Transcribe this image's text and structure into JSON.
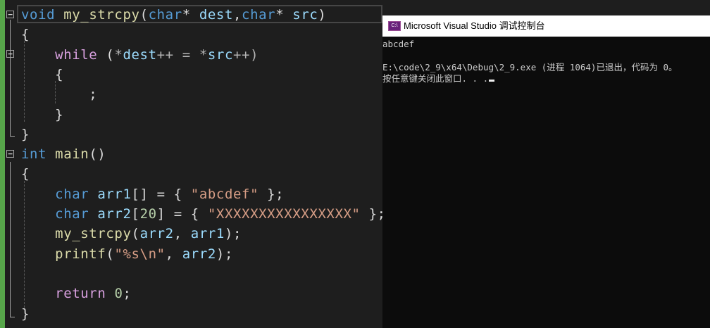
{
  "editor": {
    "lines": [
      [
        {
          "t": "void",
          "c": "kw"
        },
        {
          "t": " "
        },
        {
          "t": "my_strcpy",
          "c": "fn"
        },
        {
          "t": "("
        },
        {
          "t": "char",
          "c": "kw"
        },
        {
          "t": "* "
        },
        {
          "t": "dest",
          "c": "var"
        },
        {
          "t": ","
        },
        {
          "t": "char",
          "c": "kw"
        },
        {
          "t": "* "
        },
        {
          "t": "src",
          "c": "var"
        },
        {
          "t": ")"
        }
      ],
      [
        {
          "t": "{"
        }
      ],
      [
        {
          "t": "    "
        },
        {
          "t": "while",
          "c": "ctrl"
        },
        {
          "t": " ("
        },
        {
          "t": "*",
          "c": "op"
        },
        {
          "t": "dest",
          "c": "var"
        },
        {
          "t": "++ = ",
          "c": "op"
        },
        {
          "t": "*",
          "c": "op"
        },
        {
          "t": "src",
          "c": "var"
        },
        {
          "t": "++)",
          "c": "op"
        }
      ],
      [
        {
          "t": "    {"
        }
      ],
      [
        {
          "t": "        ;"
        }
      ],
      [
        {
          "t": "    }"
        }
      ],
      [
        {
          "t": "}"
        }
      ],
      [
        {
          "t": "int",
          "c": "kw"
        },
        {
          "t": " "
        },
        {
          "t": "main",
          "c": "fn"
        },
        {
          "t": "()"
        }
      ],
      [
        {
          "t": "{"
        }
      ],
      [
        {
          "t": "    "
        },
        {
          "t": "char",
          "c": "kw"
        },
        {
          "t": " "
        },
        {
          "t": "arr1",
          "c": "var"
        },
        {
          "t": "[] = { "
        },
        {
          "t": "\"abcdef\"",
          "c": "str"
        },
        {
          "t": " };"
        }
      ],
      [
        {
          "t": "    "
        },
        {
          "t": "char",
          "c": "kw"
        },
        {
          "t": " "
        },
        {
          "t": "arr2",
          "c": "var"
        },
        {
          "t": "["
        },
        {
          "t": "20",
          "c": "num"
        },
        {
          "t": "] = { "
        },
        {
          "t": "\"XXXXXXXXXXXXXXXX\"",
          "c": "str"
        },
        {
          "t": " };"
        }
      ],
      [
        {
          "t": "    "
        },
        {
          "t": "my_strcpy",
          "c": "fn"
        },
        {
          "t": "("
        },
        {
          "t": "arr2",
          "c": "var"
        },
        {
          "t": ", "
        },
        {
          "t": "arr1",
          "c": "var"
        },
        {
          "t": ");"
        }
      ],
      [
        {
          "t": "    "
        },
        {
          "t": "printf",
          "c": "fn"
        },
        {
          "t": "("
        },
        {
          "t": "\"%s\\n\"",
          "c": "str"
        },
        {
          "t": ", "
        },
        {
          "t": "arr2",
          "c": "var"
        },
        {
          "t": ");"
        }
      ],
      [
        {
          "t": ""
        }
      ],
      [
        {
          "t": "    "
        },
        {
          "t": "return",
          "c": "ctrl"
        },
        {
          "t": " "
        },
        {
          "t": "0",
          "c": "num"
        },
        {
          "t": ";"
        }
      ],
      [
        {
          "t": "}"
        }
      ]
    ],
    "fold_markers": [
      "−",
      "−",
      "−"
    ]
  },
  "console": {
    "icon_label": "C:\\",
    "title": "Microsoft Visual Studio 调试控制台",
    "output": [
      "abcdef",
      "",
      "E:\\code\\2_9\\x64\\Debug\\2_9.exe (进程 1064)已退出，代码为 0。",
      "按任意键关闭此窗口. . ."
    ]
  }
}
